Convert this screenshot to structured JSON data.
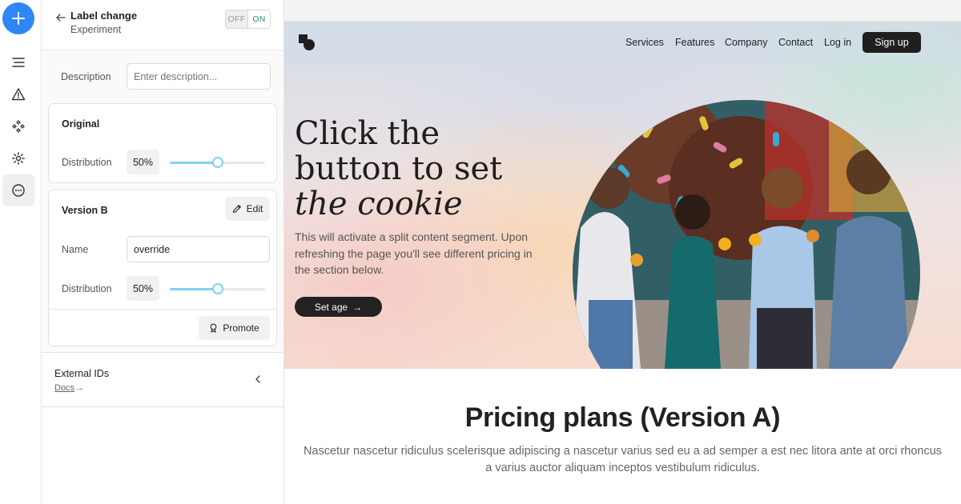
{
  "rail": {
    "items": [
      {
        "icon": "plus-icon"
      },
      {
        "icon": "list-icon"
      },
      {
        "icon": "warning-icon"
      },
      {
        "icon": "diamond-grid-icon"
      },
      {
        "icon": "gear-icon"
      },
      {
        "icon": "more-circle-icon",
        "active": true
      }
    ]
  },
  "panel": {
    "title": "Label change",
    "subtitle": "Experiment",
    "toggle": {
      "off": "OFF",
      "on": "ON",
      "state": "ON"
    },
    "description": {
      "label": "Description",
      "placeholder": "Enter description...",
      "value": ""
    },
    "original": {
      "title": "Original",
      "distribution_label": "Distribution",
      "distribution_value": "50%",
      "distribution_fraction": 0.5
    },
    "version_b": {
      "title": "Version B",
      "edit_label": "Edit",
      "name_label": "Name",
      "name_value": "override",
      "distribution_label": "Distribution",
      "distribution_value": "50%",
      "distribution_fraction": 0.5,
      "promote_label": "Promote"
    },
    "external": {
      "title": "External IDs",
      "docs_label": "Docs",
      "docs_arrow": "→"
    }
  },
  "preview": {
    "nav": {
      "links": [
        "Services",
        "Features",
        "Company",
        "Contact",
        "Log in"
      ],
      "signup": "Sign up"
    },
    "hero": {
      "headline_line1": "Click the",
      "headline_line2": "button to set",
      "headline_line3": "the cookie",
      "text": "This will activate a split content segment. Upon refreshing the page you'll see different pricing in the section below.",
      "cta": "Set age",
      "cta_arrow": "→"
    },
    "pricing": {
      "title": "Pricing plans (Version A)",
      "description": "Nascetur nascetur ridiculus scelerisque adipiscing a nascetur varius sed eu a ad semper a est nec litora ante at orci rhoncus a varius auctor aliquam inceptos vestibulum ridiculus."
    }
  },
  "colors": {
    "accent": "#2f86f6",
    "slider": "#7ed3ef",
    "toggle_on": "#2a8a5a",
    "dark_button": "#1f1f1f"
  }
}
